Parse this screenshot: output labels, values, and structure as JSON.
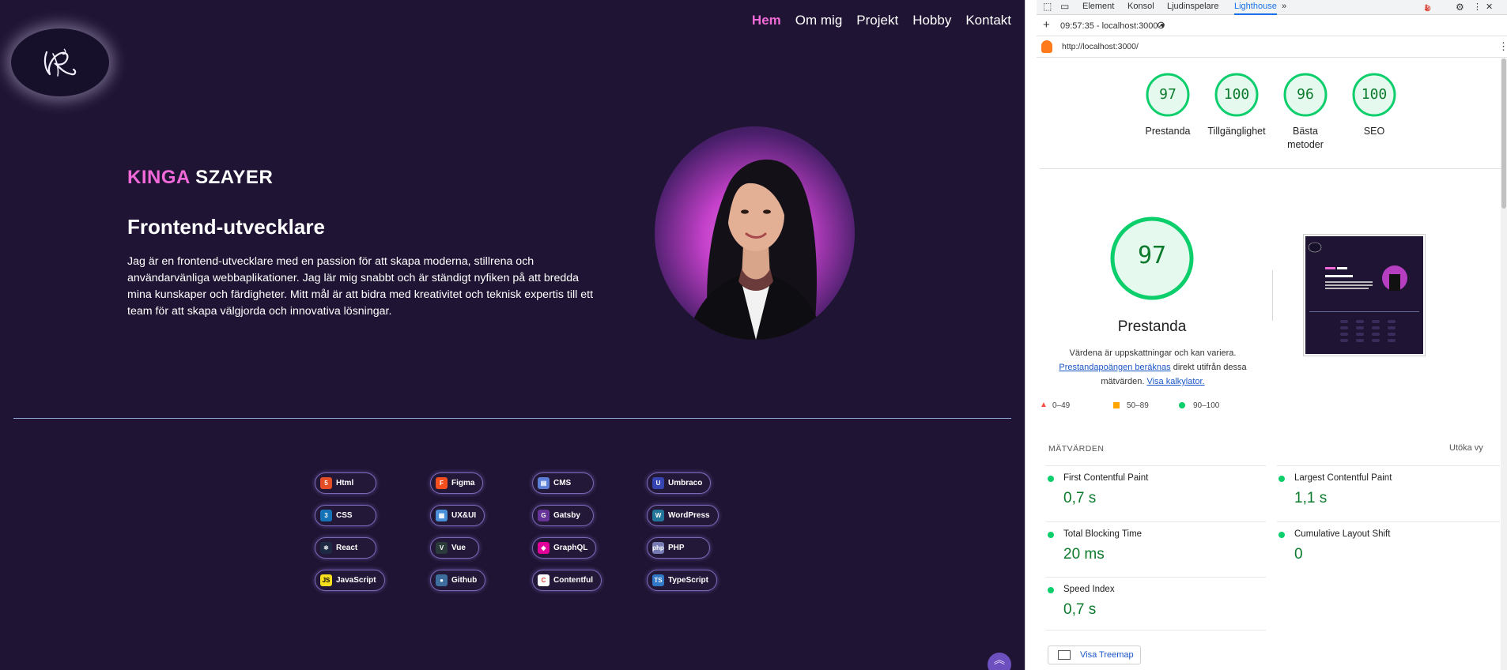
{
  "site": {
    "nav": [
      {
        "label": "Hem",
        "active": true
      },
      {
        "label": "Om mig"
      },
      {
        "label": "Projekt"
      },
      {
        "label": "Hobby"
      },
      {
        "label": "Kontakt"
      }
    ],
    "name_first": "KINGA",
    "name_last": "SZAYER",
    "role": "Frontend-utvecklare",
    "description": "Jag är en frontend-utvecklare med en passion för att skapa moderna, stillrena och användarvänliga webbaplikationer. Jag lär mig snabbt och är ständigt nyfiken på att bredda mina kunskaper och färdigheter. Mitt mål är att bidra med kreativitet och teknisk expertis till ett team för att skapa välgjorda och innovativa lösningar.",
    "skills": [
      {
        "label": "Html",
        "icon": "html5-icon",
        "color": "#e44d26",
        "glyph": "5"
      },
      {
        "label": "Figma",
        "icon": "figma-icon",
        "color": "#f24e1e",
        "glyph": "F"
      },
      {
        "label": "CMS",
        "icon": "cms-icon",
        "color": "#5b7fd6",
        "glyph": "▤"
      },
      {
        "label": "Umbraco",
        "icon": "umbraco-icon",
        "color": "#3544b1",
        "glyph": "U"
      },
      {
        "label": "CSS",
        "icon": "css3-icon",
        "color": "#1572b6",
        "glyph": "3"
      },
      {
        "label": "UX&UI",
        "icon": "uxui-icon",
        "color": "#4a90d9",
        "glyph": "▦"
      },
      {
        "label": "Gatsby",
        "icon": "gatsby-icon",
        "color": "#663399",
        "glyph": "G"
      },
      {
        "label": "WordPress",
        "icon": "wordpress-icon",
        "color": "#21759b",
        "glyph": "W"
      },
      {
        "label": "React",
        "icon": "react-icon",
        "color": "#1e2a44",
        "glyph": "⚛"
      },
      {
        "label": "Vue",
        "icon": "vue-icon",
        "color": "#2b3a3a",
        "glyph": "V"
      },
      {
        "label": "GraphQL",
        "icon": "graphql-icon",
        "color": "#e10098",
        "glyph": "◈"
      },
      {
        "label": "PHP",
        "icon": "php-icon",
        "color": "#777bb3",
        "glyph": "php"
      },
      {
        "label": "JavaScript",
        "icon": "javascript-icon",
        "color": "#f7df1e",
        "glyph": "JS"
      },
      {
        "label": "Github",
        "icon": "github-icon",
        "color": "#3d6e9e",
        "glyph": "●"
      },
      {
        "label": "Contentful",
        "icon": "contentful-icon",
        "color": "#ffffff",
        "glyph": "C"
      },
      {
        "label": "TypeScript",
        "icon": "typescript-icon",
        "color": "#3178c6",
        "glyph": "TS"
      }
    ]
  },
  "devtools": {
    "tabs": [
      "Element",
      "Konsol",
      "Ljudinspelare",
      "Lighthouse"
    ],
    "active_tab": "Lighthouse",
    "error_count": "1",
    "report_selector": "09:57:35 - localhost:3000 ▾",
    "url": "http://localhost:3000/",
    "scores": [
      {
        "value": "97",
        "label": "Prestanda"
      },
      {
        "value": "100",
        "label": "Tillgänglighet"
      },
      {
        "value": "96",
        "label": "Bästa metoder"
      },
      {
        "value": "100",
        "label": "SEO"
      }
    ],
    "main_score": "97",
    "main_label": "Prestanda",
    "note_1": "Värdena är uppskattningar och kan variera.",
    "note_link_1": "Prestandapoängen beräknas",
    "note_2": " direkt utifrån dessa",
    "note_3": "mätvärden. ",
    "note_link_2": "Visa kalkylator.",
    "legend": [
      {
        "range": "0–49",
        "color": "#ff4e42"
      },
      {
        "range": "50–89",
        "color": "#ffa400"
      },
      {
        "range": "90–100",
        "color": "#0cce6b"
      }
    ],
    "metrics_title": "MÄTVÄRDEN",
    "expand_label": "Utöka vy",
    "metrics": [
      {
        "name": "First Contentful Paint",
        "value": "0,7 s"
      },
      {
        "name": "Largest Contentful Paint",
        "value": "1,1 s"
      },
      {
        "name": "Total Blocking Time",
        "value": "20 ms"
      },
      {
        "name": "Cumulative Layout Shift",
        "value": "0"
      },
      {
        "name": "Speed Index",
        "value": "0,7 s"
      }
    ],
    "treemap_label": "Visa Treemap"
  }
}
